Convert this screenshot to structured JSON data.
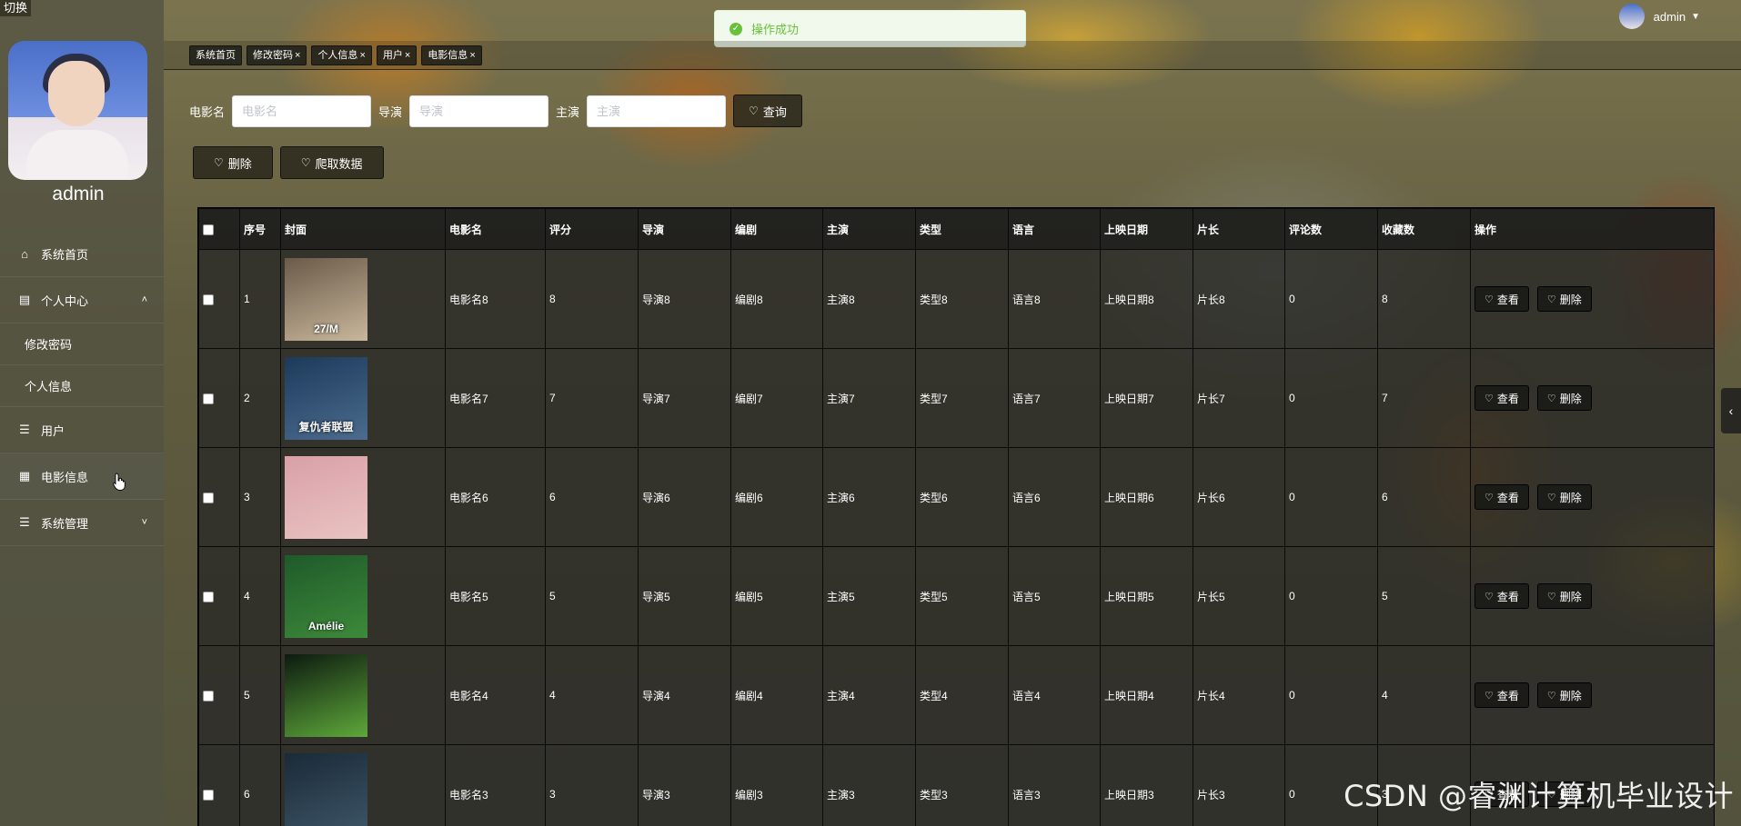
{
  "sidebar": {
    "switch_label": "切换",
    "username": "admin",
    "menu": [
      {
        "icon": "home-icon",
        "glyph": "⌂",
        "label": "系统首页",
        "type": "item"
      },
      {
        "icon": "calendar-icon",
        "glyph": "▤",
        "label": "个人中心",
        "type": "group",
        "chevron": "˄"
      },
      {
        "label": "修改密码",
        "type": "sub"
      },
      {
        "label": "个人信息",
        "type": "sub"
      },
      {
        "icon": "list-icon",
        "glyph": "☰",
        "label": "用户",
        "type": "item"
      },
      {
        "icon": "grid-icon",
        "glyph": "▦",
        "label": "电影信息",
        "type": "item",
        "active": true
      },
      {
        "icon": "list-icon",
        "glyph": "☰",
        "label": "系统管理",
        "type": "group",
        "chevron": "˅"
      }
    ]
  },
  "header": {
    "user": "admin",
    "toast": "操作成功"
  },
  "tags": [
    {
      "label": "系统首页",
      "closable": false
    },
    {
      "label": "修改密码",
      "closable": true
    },
    {
      "label": "个人信息",
      "closable": true
    },
    {
      "label": "用户",
      "closable": true
    },
    {
      "label": "电影信息",
      "closable": true
    }
  ],
  "search": {
    "fields": [
      {
        "label": "电影名",
        "placeholder": "电影名"
      },
      {
        "label": "导演",
        "placeholder": "导演"
      },
      {
        "label": "主演",
        "placeholder": "主演"
      }
    ],
    "query_label": "查询"
  },
  "actions": {
    "delete_label": "删除",
    "crawl_label": "爬取数据"
  },
  "table": {
    "columns": [
      "",
      "序号",
      "封面",
      "电影名",
      "评分",
      "导演",
      "编剧",
      "主演",
      "类型",
      "语言",
      "上映日期",
      "片长",
      "评论数",
      "收藏数",
      "操作"
    ],
    "view_label": "查看",
    "delete_label": "删除",
    "rows": [
      {
        "index": "1",
        "name": "电影名8",
        "rating": "8",
        "director": "导演8",
        "writer": "编剧8",
        "actor": "主演8",
        "genre": "类型8",
        "language": "语言8",
        "date": "上映日期8",
        "length": "片长8",
        "comments": "0",
        "favorites": "8",
        "cover_text": "27/M",
        "cover_colors": [
          "#6a5a48",
          "#c9b79c"
        ]
      },
      {
        "index": "2",
        "name": "电影名7",
        "rating": "7",
        "director": "导演7",
        "writer": "编剧7",
        "actor": "主演7",
        "genre": "类型7",
        "language": "语言7",
        "date": "上映日期7",
        "length": "片长7",
        "comments": "0",
        "favorites": "7",
        "cover_text": "复仇者联盟",
        "cover_colors": [
          "#1d3a5a",
          "#4b6c8f"
        ]
      },
      {
        "index": "3",
        "name": "电影名6",
        "rating": "6",
        "director": "导演6",
        "writer": "编剧6",
        "actor": "主演6",
        "genre": "类型6",
        "language": "语言6",
        "date": "上映日期6",
        "length": "片长6",
        "comments": "0",
        "favorites": "6",
        "cover_text": "",
        "cover_colors": [
          "#d9a0a8",
          "#e9c3c2"
        ]
      },
      {
        "index": "4",
        "name": "电影名5",
        "rating": "5",
        "director": "导演5",
        "writer": "编剧5",
        "actor": "主演5",
        "genre": "类型5",
        "language": "语言5",
        "date": "上映日期5",
        "length": "片长5",
        "comments": "0",
        "favorites": "5",
        "cover_text": "Amélie",
        "cover_colors": [
          "#1f5a2a",
          "#3d8a3a"
        ]
      },
      {
        "index": "5",
        "name": "电影名4",
        "rating": "4",
        "director": "导演4",
        "writer": "编剧4",
        "actor": "主演4",
        "genre": "类型4",
        "language": "语言4",
        "date": "上映日期4",
        "length": "片长4",
        "comments": "0",
        "favorites": "4",
        "cover_text": "",
        "cover_colors": [
          "#0d1a10",
          "#5ea83a"
        ]
      },
      {
        "index": "6",
        "name": "电影名3",
        "rating": "3",
        "director": "导演3",
        "writer": "编剧3",
        "actor": "主演3",
        "genre": "类型3",
        "language": "语言3",
        "date": "上映日期3",
        "length": "片长3",
        "comments": "0",
        "favorites": "3",
        "cover_text": "",
        "cover_colors": [
          "#1a2a38",
          "#3e5668"
        ]
      }
    ]
  },
  "watermark": "CSDN @睿渊计算机毕业设计",
  "colors": {
    "toast_bg": "#f0f9eb",
    "toast_text": "#67c23a",
    "sidebar_bg": "#505040",
    "button_bg": "#2d2a1e"
  }
}
